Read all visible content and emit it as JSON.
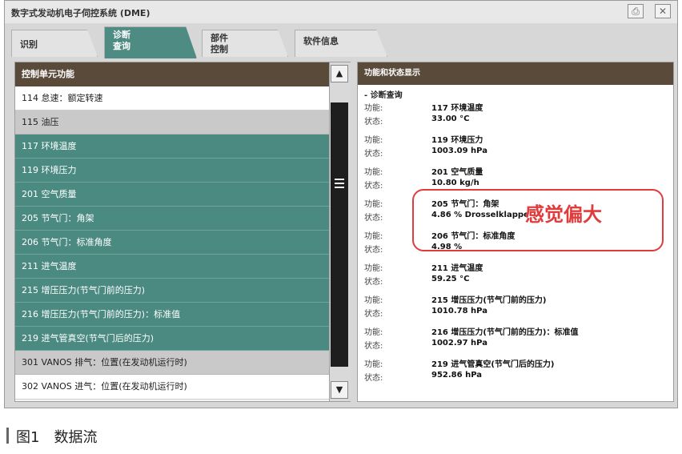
{
  "window": {
    "title": "数字式发动机电子伺控系统 (DME)"
  },
  "tabs": [
    {
      "line1": "识别",
      "line2": ""
    },
    {
      "line1": "诊断",
      "line2": "查询"
    },
    {
      "line1": "部件",
      "line2": "控制"
    },
    {
      "line1": "软件信息",
      "line2": ""
    }
  ],
  "left_panel": {
    "header": "控制单元功能",
    "items": [
      "114 怠速：额定转速",
      "115 油压",
      "117 环境温度",
      "119 环境压力",
      "201 空气质量",
      "205 节气门：角架",
      "206 节气门：标准角度",
      "211 进气温度",
      "215 增压压力(节气门前的压力)",
      "216 增压压力(节气门前的压力)：标准值",
      "219 进气管真空(节气门后的压力)",
      "301 VANOS 排气：位置(在发动机运行时)",
      "302 VANOS 进气：位置(在发动机运行时)"
    ]
  },
  "right_panel": {
    "header": "功能和状态显示",
    "section": "- 诊断查询",
    "func_label": "功能:",
    "state_label": "状态:",
    "entries": [
      {
        "func": "117 环境温度",
        "state": "33.00 °C"
      },
      {
        "func": "119 环境压力",
        "state": "1003.09 hPa"
      },
      {
        "func": "201 空气质量",
        "state": "10.80 kg/h"
      },
      {
        "func": "205 节气门：角架",
        "state": "4.86 % Drosselklappe"
      },
      {
        "func": "206 节气门：标准角度",
        "state": "4.98 %"
      },
      {
        "func": "211 进气温度",
        "state": "59.25 °C"
      },
      {
        "func": "215 增压压力(节气门前的压力)",
        "state": "1010.78 hPa"
      },
      {
        "func": "216 增压压力(节气门前的压力)：标准值",
        "state": "1002.97 hPa"
      },
      {
        "func": "219 进气管真空(节气门后的压力)",
        "state": "952.86 hPa"
      }
    ]
  },
  "annotation": "感觉偏大",
  "caption": "图1　数据流",
  "colors": {
    "teal": "#4a8a81",
    "header_brown": "#5a4a3a",
    "annotation_red": "#e23b3b"
  }
}
